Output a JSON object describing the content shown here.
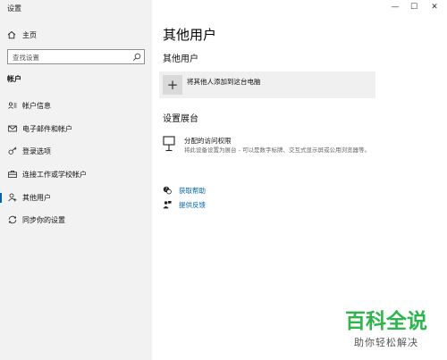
{
  "window": {
    "title": "设置",
    "minimize": "—",
    "maximize": "☐",
    "close": "✕"
  },
  "sidebar": {
    "home_label": "主页",
    "search_placeholder": "查找设置",
    "section_title": "帐户",
    "items": [
      {
        "label": "帐户信息",
        "icon": "account-info-icon"
      },
      {
        "label": "电子邮件和帐户",
        "icon": "mail-icon"
      },
      {
        "label": "登录选项",
        "icon": "key-icon"
      },
      {
        "label": "连接工作或学校帐户",
        "icon": "briefcase-icon"
      },
      {
        "label": "其他用户",
        "icon": "person-add-icon",
        "active": true
      },
      {
        "label": "同步你的设置",
        "icon": "sync-icon"
      }
    ]
  },
  "main": {
    "title": "其他用户",
    "subtitle": "其他用户",
    "add_icon": "+",
    "add_label": "将其他人添加到这台电脑",
    "kiosk_title": "设置展台",
    "kiosk_label": "分配的访问权限",
    "kiosk_desc": "将此设备设置为展台 - 可以是数字标牌、交互式显示屏或公用浏览器等。",
    "help_label": "获取帮助",
    "feedback_label": "提供反馈"
  },
  "watermark": {
    "brand": "百科全说",
    "slogan": "助你轻松解决"
  },
  "colors": {
    "accent": "#0063b1",
    "sidebar_bg": "#f2f2f2",
    "watermark_green": "#2db64c"
  }
}
